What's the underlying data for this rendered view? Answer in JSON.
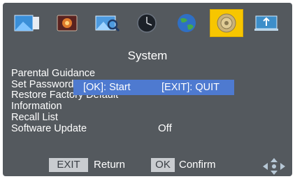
{
  "icon_bar": {
    "icons": [
      "picture-icon",
      "media-icon",
      "search-icon",
      "clock-icon",
      "globe-icon",
      "settings-gear-icon",
      "usb-icon"
    ],
    "selected": "settings-gear-icon",
    "selected_color": "#f7c600"
  },
  "title": "System",
  "menu": {
    "items": [
      "Parental Guidance",
      "Set Password",
      "Restore Factory Default",
      "Information",
      "Recall List",
      "Software Update"
    ],
    "recall_list_value": "Off"
  },
  "popup": {
    "ok_text": "[OK]: Start",
    "exit_text": "[EXIT]: QUIT",
    "background_color": "#4e7ad0"
  },
  "footer": {
    "exit_key": "EXIT",
    "exit_label": "Return",
    "ok_key": "OK",
    "ok_label": "Confirm",
    "nav_icon": "navigation-arrows-icon"
  },
  "colors": {
    "background": "#54595e",
    "text": "#ffffff",
    "keycap": "#c9ccd0"
  }
}
